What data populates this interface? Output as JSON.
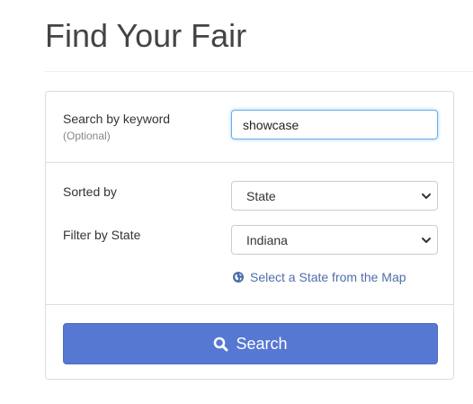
{
  "page": {
    "title": "Find Your Fair"
  },
  "keyword": {
    "label": "Search by keyword",
    "sublabel": "(Optional)",
    "value": "showcase"
  },
  "sort": {
    "label": "Sorted by",
    "selected": "State"
  },
  "state_filter": {
    "label": "Filter by State",
    "selected": "Indiana",
    "map_link": "Select a State from the Map"
  },
  "search_button": {
    "label": "Search"
  },
  "colors": {
    "accent": "#5677d2",
    "link": "#4d6fa8",
    "focus_border": "#66afe9"
  },
  "icons": {
    "map_link": "globe-icon",
    "search_button": "search-icon",
    "select_arrow": "chevron-down-icon"
  }
}
